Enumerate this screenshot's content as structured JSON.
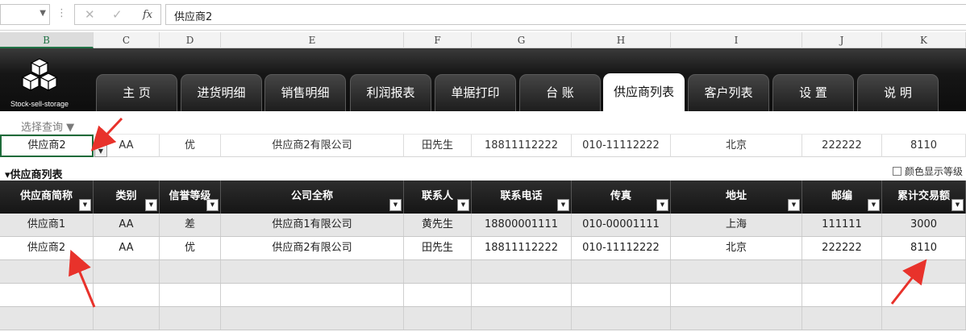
{
  "formula_bar": {
    "namebox_value": "",
    "cancel_icon": "close-icon",
    "enter_icon": "check-icon",
    "fx_label": "fx",
    "value": "供应商2"
  },
  "columns": [
    "B",
    "C",
    "D",
    "E",
    "F",
    "G",
    "H",
    "I",
    "J",
    "K"
  ],
  "logo_text": "Stock-sell-storage",
  "tabs": [
    "主 页",
    "进货明细",
    "销售明细",
    "利润报表",
    "单据打印",
    "台 账",
    "供应商列表",
    "客户列表",
    "设 置",
    "说 明"
  ],
  "active_tab": "供应商列表",
  "query": {
    "label": "选择查询 ▼",
    "selected": "供应商2",
    "values": [
      "AA",
      "优",
      "供应商2有限公司",
      "田先生",
      "18811112222",
      "010-11112222",
      "北京",
      "222222",
      "8110"
    ]
  },
  "section": {
    "title": "▾供应商列表",
    "color_option_label": "颜色显示等级"
  },
  "table": {
    "headers": [
      "供应商简称",
      "类别",
      "信誉等级",
      "公司全称",
      "联系人",
      "联系电话",
      "传真",
      "地址",
      "邮编",
      "累计交易额"
    ],
    "rows": [
      [
        "供应商1",
        "AA",
        "差",
        "供应商1有限公司",
        "黄先生",
        "18800001111",
        "010-00001111",
        "上海",
        "111111",
        "3000"
      ],
      [
        "供应商2",
        "AA",
        "优",
        "供应商2有限公司",
        "田先生",
        "18811112222",
        "010-11112222",
        "北京",
        "222222",
        "8110"
      ],
      [
        "",
        "",
        "",
        "",
        "",
        "",
        "",
        "",
        "",
        ""
      ],
      [
        "",
        "",
        "",
        "",
        "",
        "",
        "",
        "",
        "",
        ""
      ],
      [
        "",
        "",
        "",
        "",
        "",
        "",
        "",
        "",
        "",
        ""
      ]
    ]
  },
  "colors": {
    "arrow": "#e8322b",
    "selection": "#1e6b3a",
    "nav_bg": "#0d0d0d"
  }
}
